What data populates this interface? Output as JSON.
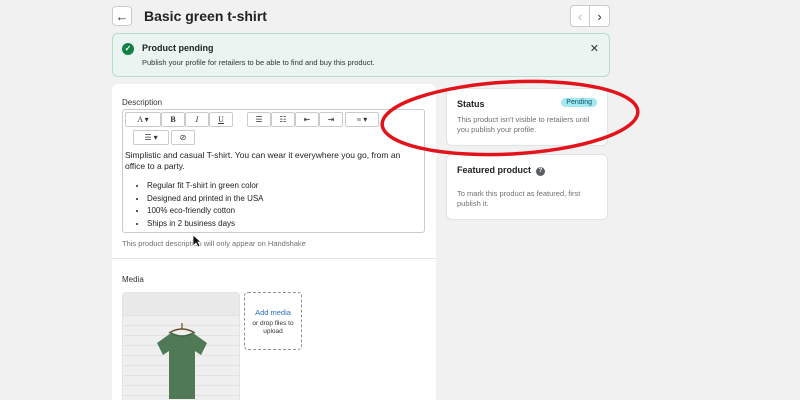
{
  "header": {
    "back_icon": "←",
    "title": "Basic green t-shirt",
    "prev_icon": "‹",
    "next_icon": "›"
  },
  "banner": {
    "check_icon": "✓",
    "title": "Product pending",
    "text": "Publish your profile for retailers to be able to find and buy this product.",
    "close_icon": "✕"
  },
  "description": {
    "label": "Description",
    "toolbar": {
      "font": "A ▾",
      "bold": "B",
      "italic": "I",
      "underline": "U",
      "bullet_list": "☰",
      "numbered_list": "☷",
      "outdent": "⇤",
      "indent": "⇥",
      "align": "≡ ▾",
      "more": "☰ ▾",
      "clear": "⊘"
    },
    "paragraph": "Simplistic and casual T-shirt. You can wear it everywhere you go, from an office to a party.",
    "bullets": [
      "Regular fit T-shirt in green color",
      "Designed and printed in the USA",
      "100% eco-friendly cotton",
      "Ships in 2 business days"
    ],
    "help_text": "This product description will only appear on Handshake"
  },
  "media": {
    "label": "Media",
    "add_media": "Add media",
    "drop_text": "or drop files to upload"
  },
  "status": {
    "title": "Status",
    "badge": "Pending",
    "text": "This product isn't visible to retailers until you publish your profile."
  },
  "featured": {
    "title": "Featured product",
    "help_icon": "?",
    "text": "To mark this product as featured, first publish it."
  },
  "colors": {
    "accent": "#108043",
    "badge_bg": "#a4e8f2",
    "annotation": "#e3131b",
    "link": "#2c6ecb"
  }
}
